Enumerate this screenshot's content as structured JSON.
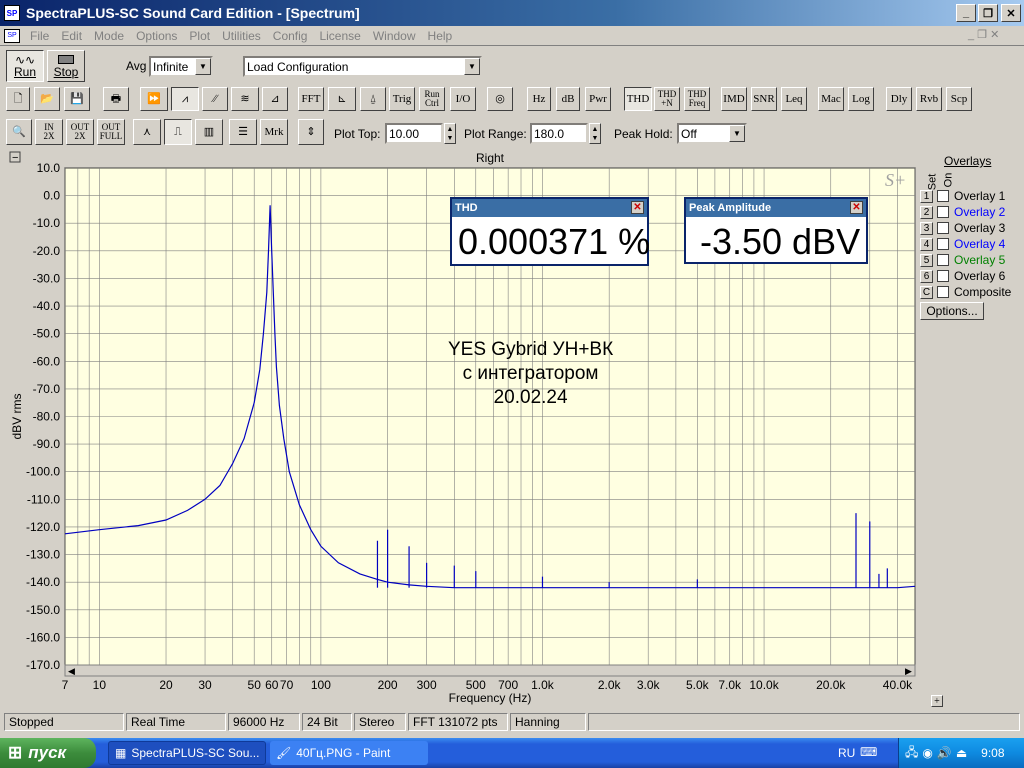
{
  "window": {
    "title": "SpectraPLUS-SC Sound Card Edition - [Spectrum]"
  },
  "menu": [
    "File",
    "Edit",
    "Mode",
    "Options",
    "Plot",
    "Utilities",
    "Config",
    "License",
    "Window",
    "Help"
  ],
  "toolbar1": {
    "run": "Run",
    "stop": "Stop",
    "avg_label": "Avg",
    "avg_value": "Infinite",
    "load_config": "Load Configuration"
  },
  "toolbar2": [
    "FFT",
    "Trig",
    "Run Ctrl",
    "I/O",
    "Hz",
    "dB",
    "Pwr",
    "THD",
    "THD +N",
    "THD Freq",
    "IMD",
    "SNR",
    "Leq",
    "Mac",
    "Log",
    "Dly",
    "Rvb",
    "Scp"
  ],
  "toolbar3": {
    "mrk": "Mrk",
    "plot_top_label": "Plot Top:",
    "plot_top": "10.00",
    "plot_range_label": "Plot Range:",
    "plot_range": "180.0",
    "peak_hold_label": "Peak Hold:",
    "peak_hold": "Off"
  },
  "plot": {
    "channel": "Right",
    "ylabel": "dBV rms",
    "xlabel": "Frequency (Hz)",
    "logo": "S+"
  },
  "annotation": {
    "line1": "YES Gybrid  УН+ВК",
    "line2": "с интегратором",
    "line3": "20.02.24"
  },
  "thd": {
    "title": "THD",
    "value": "0.000371 %"
  },
  "peak": {
    "title": "Peak Amplitude",
    "value": "-3.50 dBV"
  },
  "overlays": {
    "title": "Overlays",
    "set": "Set",
    "on": "On",
    "items": [
      {
        "num": "1",
        "label": "Overlay 1",
        "color": "#000000"
      },
      {
        "num": "2",
        "label": "Overlay 2",
        "color": "#0000ff"
      },
      {
        "num": "3",
        "label": "Overlay 3",
        "color": "#000000"
      },
      {
        "num": "4",
        "label": "Overlay 4",
        "color": "#0000ff"
      },
      {
        "num": "5",
        "label": "Overlay 5",
        "color": "#008000"
      },
      {
        "num": "6",
        "label": "Overlay 6",
        "color": "#000000"
      },
      {
        "num": "C",
        "label": "Composite",
        "color": "#000000"
      }
    ],
    "options": "Options..."
  },
  "status": {
    "state": "Stopped",
    "mode": "Real Time",
    "rate": "96000 Hz",
    "bits": "24 Bit",
    "channels": "Stereo",
    "fft": "FFT 131072 pts",
    "window": "Hanning"
  },
  "taskbar": {
    "start": "пуск",
    "task1": "SpectraPLUS-SC Sou...",
    "task2": "40Гц.PNG - Paint",
    "lang": "RU",
    "time": "9:08"
  },
  "chart_data": {
    "type": "line",
    "xscale": "log",
    "xlim": [
      7,
      48000
    ],
    "ylim": [
      -170,
      10
    ],
    "ylabel": "dBV rms",
    "xlabel": "Frequency (Hz)",
    "x_tick_labels": [
      "7",
      "10",
      "20",
      "30",
      "50",
      "60",
      "70",
      "100",
      "200",
      "300",
      "500",
      "700",
      "1.0k",
      "2.0k",
      "3.0k",
      "5.0k",
      "7.0k",
      "10.0k",
      "20.0k",
      "40.0k"
    ],
    "x_tick_values": [
      7,
      10,
      20,
      30,
      50,
      60,
      70,
      100,
      200,
      300,
      500,
      700,
      1000,
      2000,
      3000,
      5000,
      7000,
      10000,
      20000,
      40000
    ],
    "y_tick_labels": [
      "10.0",
      "0.0",
      "-10.0",
      "-20.0",
      "-30.0",
      "-40.0",
      "-50.0",
      "-60.0",
      "-70.0",
      "-80.0",
      "-90.0",
      "-100.0",
      "-110.0",
      "-120.0",
      "-130.0",
      "-140.0",
      "-150.0",
      "-160.0",
      "-170.0"
    ],
    "y_ticks": [
      10,
      0,
      -10,
      -20,
      -30,
      -40,
      -50,
      -60,
      -70,
      -80,
      -90,
      -100,
      -110,
      -120,
      -130,
      -140,
      -150,
      -160,
      -170
    ],
    "grid": true,
    "series": [
      {
        "color": "#0000c0",
        "x": [
          7,
          10,
          15,
          20,
          25,
          30,
          35,
          40,
          45,
          50,
          53,
          55,
          57,
          58,
          59,
          60,
          61,
          62,
          63,
          65,
          68,
          72,
          80,
          90,
          100,
          120,
          150,
          180,
          200,
          250,
          300,
          400,
          500,
          700,
          1000,
          2000,
          3000,
          5000,
          10000,
          20000,
          26000,
          30000,
          35000,
          40000,
          48000
        ],
        "y": [
          -122.5,
          -121,
          -119.5,
          -117.5,
          -114,
          -110,
          -105,
          -97,
          -88,
          -75,
          -63,
          -50,
          -35,
          -20,
          -3.5,
          -20,
          -35,
          -50,
          -62,
          -76,
          -88,
          -100,
          -112,
          -121,
          -127,
          -133,
          -137,
          -139,
          -140,
          -141,
          -141.5,
          -142,
          -142,
          -142,
          -142,
          -142,
          -142,
          -142,
          -142,
          -142,
          -142,
          -142,
          -142,
          -142,
          -141.5
        ]
      },
      {
        "name": "spurs",
        "color": "#0000c0",
        "x": [
          180,
          200,
          250,
          300,
          400,
          500,
          1000,
          2000,
          5000,
          26000,
          30000,
          33000,
          36000
        ],
        "y": [
          -125,
          -121,
          -127,
          -133,
          -134,
          -136,
          -138,
          -140,
          -139,
          -115,
          -118,
          -137,
          -135
        ]
      }
    ]
  }
}
